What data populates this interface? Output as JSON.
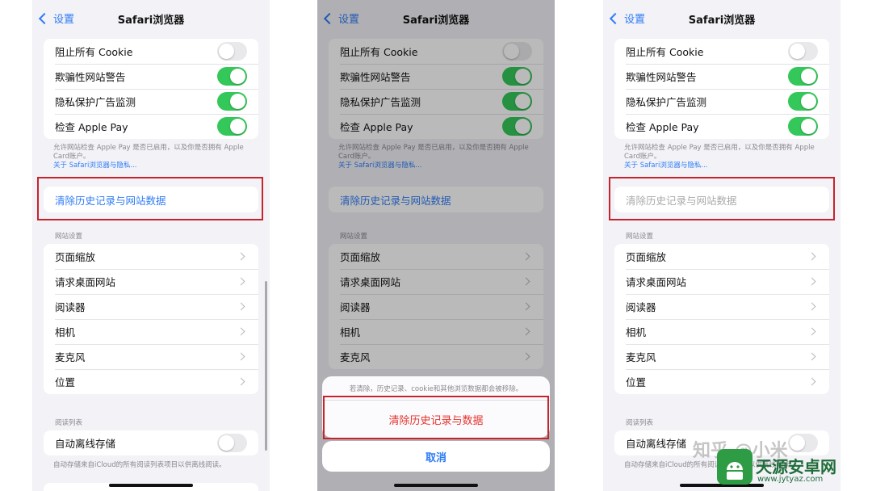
{
  "nav": {
    "back": "设置",
    "title": "Safari浏览器"
  },
  "privacy": {
    "rows": [
      {
        "label": "阻止所有 Cookie",
        "on": false
      },
      {
        "label": "欺骗性网站警告",
        "on": true
      },
      {
        "label": "隐私保护广告监测",
        "on": true
      },
      {
        "label": "检查 Apple Pay",
        "on": true
      }
    ],
    "footnote": "允许网站检查 Apple Pay 是否已启用，以及你是否拥有 Apple Card账户。",
    "link": "关于 Safari浏览器与隐私..."
  },
  "clear_history": "清除历史记录与网站数据",
  "website_settings": {
    "header": "网站设置",
    "items": [
      "页面缩放",
      "请求桌面网站",
      "阅读器",
      "相机",
      "麦克风",
      "位置"
    ]
  },
  "reading_list": {
    "header": "阅读列表",
    "row": "自动离线存储",
    "on": false,
    "footnote": "自动存储来自iCloud的所有阅读列表项目以供离线阅读。"
  },
  "action_sheet": {
    "message": "若清除，历史记录、cookie和其他浏览数据都会被移除。",
    "confirm": "清除历史记录与数据",
    "cancel": "取消"
  },
  "watermark": {
    "zhihu": "知乎 @小米",
    "brand": "天源安卓网",
    "url": "www.jytyaz.com"
  },
  "colors": {
    "ios_blue": "#2f7cf6",
    "toggle_green": "#34c759",
    "destructive_red": "#e6322c",
    "highlight_red": "#c8232c"
  }
}
